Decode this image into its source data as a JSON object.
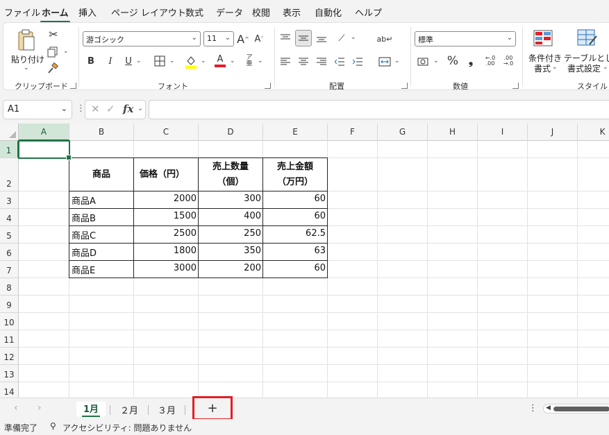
{
  "menu": [
    "ファイル",
    "ホーム",
    "挿入",
    "ページ レイアウト",
    "数式",
    "データ",
    "校閲",
    "表示",
    "自動化",
    "ヘルプ"
  ],
  "menu_active": "ホーム",
  "accent_color": "#217346",
  "highlight_color": "#e41e26",
  "ribbon": {
    "clipboard": {
      "paste_label": "貼り付け",
      "group_label": "クリップボード"
    },
    "font": {
      "font_name": "游ゴシック",
      "font_size": "11",
      "bold": "B",
      "italic": "I",
      "underline": "U",
      "group_label": "フォント"
    },
    "alignment": {
      "group_label": "配置"
    },
    "number": {
      "format": "標準",
      "percent": "%",
      "comma": "❟",
      "group_label": "数値"
    },
    "styles": {
      "cond_format_line1": "条件付き",
      "cond_format_line2": "書式",
      "table_format_line1": "テーブルとして",
      "table_format_line2": "書式設定",
      "group_label": "スタイル"
    }
  },
  "formula_bar": {
    "name_box": "A1",
    "fx": "fx",
    "formula": ""
  },
  "columns": [
    "A",
    "B",
    "C",
    "D",
    "E",
    "F",
    "G",
    "H",
    "I",
    "J",
    "K"
  ],
  "rows": [
    "1",
    "2",
    "3",
    "4",
    "5",
    "6",
    "7",
    "8",
    "9",
    "10",
    "11",
    "12",
    "13",
    "14"
  ],
  "table": {
    "headers": [
      {
        "line1": "商品",
        "line2": ""
      },
      {
        "line1": "価格（円）",
        "line2": ""
      },
      {
        "line1": "売上数量",
        "line2": "（個）"
      },
      {
        "line1": "売上金額",
        "line2": "（万円）"
      }
    ],
    "rows": [
      [
        "商品A",
        "2000",
        "300",
        "60"
      ],
      [
        "商品B",
        "1500",
        "400",
        "60"
      ],
      [
        "商品C",
        "2500",
        "250",
        "62.5"
      ],
      [
        "商品D",
        "1800",
        "350",
        "63"
      ],
      [
        "商品E",
        "3000",
        "200",
        "60"
      ]
    ]
  },
  "sheets": {
    "tabs": [
      "1月",
      "２月",
      "３月"
    ],
    "active": "1月",
    "add_label": "+"
  },
  "status": {
    "ready": "準備完了",
    "accessibility": "アクセシビリティ: 問題ありません"
  }
}
